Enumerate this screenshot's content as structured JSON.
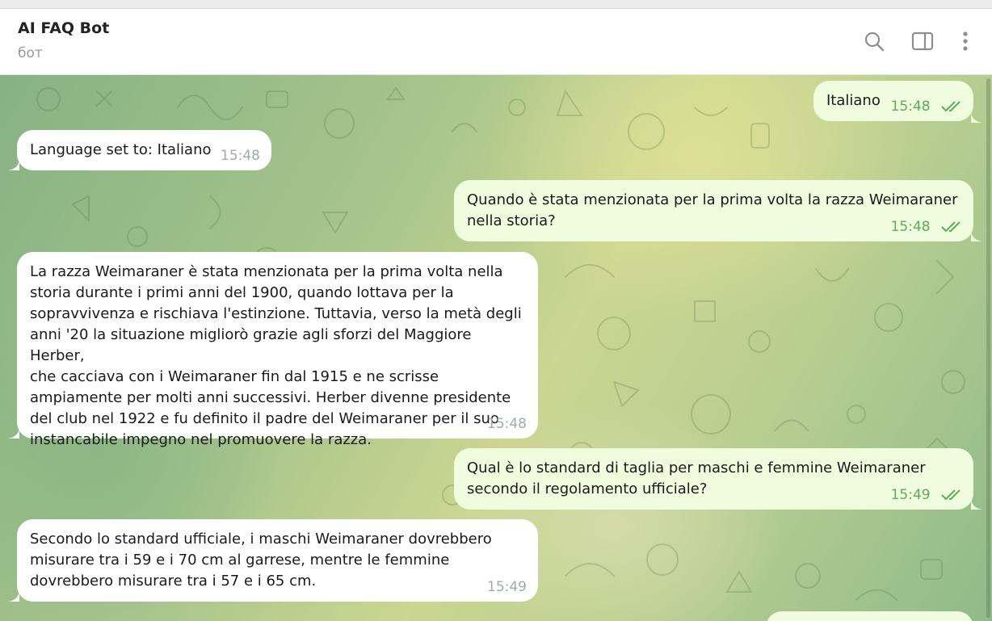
{
  "header": {
    "title": "AI FAQ Bot",
    "status": "бот",
    "icons": [
      "search-icon",
      "sidebar-toggle-icon",
      "more-vertical-icon"
    ]
  },
  "colors": {
    "incoming_bubble": "#ffffff",
    "outgoing_bubble": "#effdde",
    "outgoing_time": "#5dac5a",
    "incoming_time": "#a3a9b0"
  },
  "messages": [
    {
      "direction": "outgoing",
      "text": "Italiano",
      "time": "15:48",
      "status": "read"
    },
    {
      "direction": "incoming",
      "text": "Language set to: Italiano",
      "time": "15:48"
    },
    {
      "direction": "outgoing",
      "text": "Quando è stata menzionata per la prima volta la razza Weimaraner\nnella storia?",
      "time": "15:48",
      "status": "read"
    },
    {
      "direction": "incoming",
      "text": "La razza Weimaraner è stata menzionata per la prima volta nella\nstoria durante i primi anni del 1900, quando lottava per la\nsopravvivenza e rischiava l'estinzione. Tuttavia, verso la metà degli\nanni '20 la situazione migliorò grazie agli sforzi del Maggiore Herber,\nche cacciava con i Weimaraner fin dal 1915 e ne scrisse\nampiamente per molti anni successivi. Herber divenne presidente\ndel club nel 1922 e fu definito il padre del Weimaraner per il suo\ninstancabile impegno nel promuovere la razza.",
      "time": "15:48"
    },
    {
      "direction": "outgoing",
      "text": "Qual è lo standard di taglia per maschi e femmine Weimaraner\nsecondo il regolamento ufficiale?",
      "time": "15:49",
      "status": "read"
    },
    {
      "direction": "incoming",
      "text": "Secondo lo standard ufficiale, i maschi Weimaraner dovrebbero\nmisurare tra i 59 e i 70 cm al garrese, mentre le femmine\ndovrebbero misurare tra i 57 e i 65 cm.",
      "time": "15:49"
    }
  ]
}
